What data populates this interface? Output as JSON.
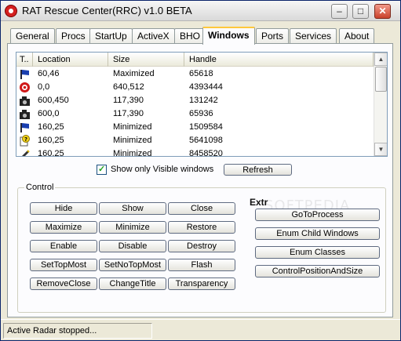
{
  "window": {
    "title": "RAT Rescue Center(RRC) v1.0 BETA"
  },
  "title_buttons": {
    "minimize": "‒",
    "maximize": "□",
    "close": "✕"
  },
  "tabs": [
    {
      "label": "General"
    },
    {
      "label": "Procs"
    },
    {
      "label": "StartUp"
    },
    {
      "label": "ActiveX"
    },
    {
      "label": "BHO"
    },
    {
      "label": "Windows",
      "active": true
    },
    {
      "label": "Ports"
    },
    {
      "label": "Services"
    },
    {
      "label": "About"
    }
  ],
  "list": {
    "columns": [
      "T..",
      "Location",
      "Size",
      "Handle"
    ],
    "rows": [
      {
        "icon": "window-flag-icon",
        "location": "60,46",
        "size": "Maximized",
        "handle": "65618"
      },
      {
        "icon": "red-alert-icon",
        "location": "0,0",
        "size": "640,512",
        "handle": "4393444"
      },
      {
        "icon": "camera-icon",
        "location": "600,450",
        "size": "117,390",
        "handle": "131242"
      },
      {
        "icon": "camera-icon",
        "location": "600,0",
        "size": "117,390",
        "handle": "65936"
      },
      {
        "icon": "window-flag-icon",
        "location": "160,25",
        "size": "Minimized",
        "handle": "1509584"
      },
      {
        "icon": "help-page-icon",
        "location": "160,25",
        "size": "Minimized",
        "handle": "5641098"
      },
      {
        "icon": "pen-icon",
        "location": "160,25",
        "size": "Minimized",
        "handle": "8458520"
      }
    ],
    "scroll_up": "▲",
    "scroll_down": "▼"
  },
  "options": {
    "show_visible_label": "Show only Visible windows",
    "show_visible_checked": true,
    "refresh_label": "Refresh"
  },
  "control": {
    "group_title": "Control",
    "buttons": [
      "Hide",
      "Show",
      "Close",
      "Maximize",
      "Minimize",
      "Restore",
      "Enable",
      "Disable",
      "Destroy",
      "SetTopMost",
      "SetNoTopMost",
      "Flash",
      "RemoveClose",
      "ChangeTitle",
      "Transparency"
    ]
  },
  "extra": {
    "label": "Extr",
    "buttons": [
      "GoToProcess",
      "Enum Child Windows",
      "Enum Classes",
      "ControlPositionAndSize"
    ]
  },
  "watermark": "SOFTPEDIA",
  "status": {
    "text": "Active Radar stopped..."
  }
}
